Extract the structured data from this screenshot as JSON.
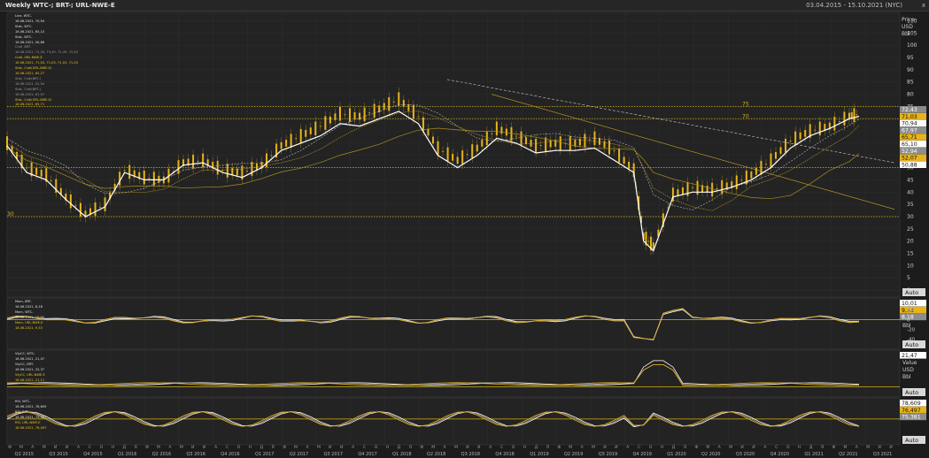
{
  "header": {
    "title": "Weekly WTC-; BRT-; URL-NWE-E",
    "date_range": "03.04.2015 - 15.10.2021 (NYC)",
    "close": "x"
  },
  "colors": {
    "bg": "#1c1c1c",
    "panel": "#232323",
    "grid": "#2f2f2f",
    "white": "#ffffff",
    "yellow": "#e8b31a",
    "gold": "#c9a227",
    "gray": "#a0a0a0",
    "level": "#d4b21a"
  },
  "chart_data": [
    {
      "type": "line",
      "panel": "price",
      "ylabel": "Price USD Bbl",
      "yticks": [
        0,
        5,
        10,
        15,
        20,
        25,
        30,
        35,
        40,
        45,
        50,
        55,
        60,
        65,
        70,
        75,
        80,
        85,
        90,
        95,
        100,
        105,
        110
      ],
      "ylim": [
        0,
        112
      ],
      "x_quarters": [
        "Q2 2015",
        "Q3 2015",
        "Q4 2015",
        "Q1 2016",
        "Q2 2016",
        "Q3 2016",
        "Q4 2016",
        "Q1 2017",
        "Q2 2017",
        "Q3 2017",
        "Q4 2017",
        "Q1 2018",
        "Q2 2018",
        "Q3 2018",
        "Q4 2018",
        "Q1 2019",
        "Q2 2019",
        "Q3 2019",
        "Q4 2019",
        "Q1 2020",
        "Q2 2020",
        "Q3 2020",
        "Q4 2020",
        "Q1 2021",
        "Q2 2021",
        "Q3 2021"
      ],
      "levels": [
        {
          "label": "75",
          "value": 75
        },
        {
          "label": "70",
          "value": 70
        },
        {
          "label": "",
          "value": 50
        },
        {
          "label": "30",
          "value": 30
        }
      ],
      "series": [
        {
          "name": "WTC",
          "points": [
            [
              0,
              59
            ],
            [
              2,
              48
            ],
            [
              4,
              45
            ],
            [
              6,
              37
            ],
            [
              8,
              30
            ],
            [
              10,
              34
            ],
            [
              12,
              48
            ],
            [
              14,
              45
            ],
            [
              16,
              45
            ],
            [
              18,
              51
            ],
            [
              20,
              52
            ],
            [
              22,
              48
            ],
            [
              24,
              46
            ],
            [
              26,
              50
            ],
            [
              28,
              57
            ],
            [
              30,
              60
            ],
            [
              32,
              63
            ],
            [
              34,
              68
            ],
            [
              36,
              67
            ],
            [
              38,
              70
            ],
            [
              40,
              73
            ],
            [
              42,
              68
            ],
            [
              44,
              55
            ],
            [
              46,
              50
            ],
            [
              48,
              55
            ],
            [
              50,
              62
            ],
            [
              52,
              60
            ],
            [
              54,
              56
            ],
            [
              56,
              57
            ],
            [
              58,
              57
            ],
            [
              60,
              58
            ],
            [
              62,
              53
            ],
            [
              64,
              48
            ],
            [
              65,
              20
            ],
            [
              66,
              16
            ],
            [
              68,
              38
            ],
            [
              70,
              40
            ],
            [
              72,
              40
            ],
            [
              74,
              42
            ],
            [
              76,
              45
            ],
            [
              78,
              50
            ],
            [
              80,
              58
            ],
            [
              82,
              63
            ],
            [
              84,
              66
            ],
            [
              86,
              70
            ],
            [
              87,
              71
            ]
          ]
        },
        {
          "name": "BRT",
          "points": [
            [
              0,
              62
            ],
            [
              2,
              52
            ],
            [
              4,
              49
            ],
            [
              6,
              40
            ],
            [
              8,
              32
            ],
            [
              10,
              37
            ],
            [
              12,
              50
            ],
            [
              14,
              47
            ],
            [
              16,
              46
            ],
            [
              18,
              53
            ],
            [
              20,
              55
            ],
            [
              22,
              50
            ],
            [
              24,
              49
            ],
            [
              26,
              53
            ],
            [
              28,
              61
            ],
            [
              30,
              65
            ],
            [
              32,
              69
            ],
            [
              34,
              74
            ],
            [
              36,
              73
            ],
            [
              38,
              76
            ],
            [
              40,
              80
            ],
            [
              42,
              73
            ],
            [
              44,
              60
            ],
            [
              46,
              55
            ],
            [
              48,
              60
            ],
            [
              50,
              68
            ],
            [
              52,
              65
            ],
            [
              54,
              61
            ],
            [
              56,
              62
            ],
            [
              58,
              62
            ],
            [
              60,
              63
            ],
            [
              62,
              58
            ],
            [
              64,
              50
            ],
            [
              65,
              26
            ],
            [
              66,
              22
            ],
            [
              68,
              40
            ],
            [
              70,
              43
            ],
            [
              72,
              42
            ],
            [
              74,
              44
            ],
            [
              76,
              48
            ],
            [
              78,
              55
            ],
            [
              80,
              63
            ],
            [
              82,
              66
            ],
            [
              84,
              68
            ],
            [
              86,
              72
            ],
            [
              87,
              73
            ]
          ]
        },
        {
          "name": "URL-NWE-E",
          "points": [
            [
              0,
              60
            ],
            [
              2,
              50
            ],
            [
              4,
              47
            ],
            [
              6,
              38
            ],
            [
              8,
              31
            ],
            [
              10,
              35
            ],
            [
              12,
              49
            ],
            [
              14,
              46
            ],
            [
              16,
              45
            ],
            [
              18,
              52
            ],
            [
              20,
              53
            ],
            [
              22,
              49
            ],
            [
              24,
              48
            ],
            [
              26,
              51
            ],
            [
              28,
              59
            ],
            [
              30,
              63
            ],
            [
              32,
              67
            ],
            [
              34,
              72
            ],
            [
              36,
              71
            ],
            [
              38,
              74
            ],
            [
              40,
              78
            ],
            [
              42,
              71
            ],
            [
              44,
              58
            ],
            [
              46,
              53
            ],
            [
              48,
              58
            ],
            [
              50,
              66
            ],
            [
              52,
              63
            ],
            [
              54,
              59
            ],
            [
              56,
              60
            ],
            [
              58,
              60
            ],
            [
              60,
              62
            ],
            [
              62,
              57
            ],
            [
              64,
              49
            ],
            [
              65,
              22
            ],
            [
              66,
              18
            ],
            [
              68,
              39
            ],
            [
              70,
              42
            ],
            [
              72,
              41
            ],
            [
              74,
              43
            ],
            [
              76,
              47
            ],
            [
              78,
              53
            ],
            [
              80,
              61
            ],
            [
              82,
              65
            ],
            [
              84,
              67
            ],
            [
              86,
              71
            ],
            [
              87,
              72
            ]
          ]
        }
      ],
      "price_labels": [
        {
          "text": "72,43",
          "style": "gray"
        },
        {
          "text": "71,03",
          "style": "yellow"
        },
        {
          "text": "70,94",
          "style": "white"
        },
        {
          "text": "67,97",
          "style": "gray"
        },
        {
          "text": "65,71",
          "style": "yellow"
        },
        {
          "text": "65,10",
          "style": "white"
        },
        {
          "text": "52,94",
          "style": "gray"
        },
        {
          "text": "52,07",
          "style": "yellow"
        },
        {
          "text": "50,88",
          "style": "white"
        }
      ],
      "legend": [
        {
          "text": "Line, WTC-",
          "c": "w"
        },
        {
          "text": "18.06.2021, 70,94",
          "c": "w"
        },
        {
          "text": "Stdc, WTC-",
          "c": "w"
        },
        {
          "text": "18.06.2021, 65,10",
          "c": "w"
        },
        {
          "text": "Stdc, WTC-",
          "c": "w"
        },
        {
          "text": "18.06.2021, 50,88",
          "c": "w"
        },
        {
          "text": "Cndl, BRT-",
          "c": "g"
        },
        {
          "text": "18.06.2021, 72,43, 73,49, 72,49, 72,43",
          "c": "g"
        },
        {
          "text": "Cndl, URL-NWE-E",
          "c": "y"
        },
        {
          "text": "18.06.2021, 71,03, 71,03, 71,03, 71,03",
          "c": "y"
        },
        {
          "text": "Stdc, Cndl(URL-NWE-E)",
          "c": "y"
        },
        {
          "text": "18.06.2021, 65,27",
          "c": "y"
        },
        {
          "text": "Stdc, Cndl(BRT-)",
          "c": "g"
        },
        {
          "text": "18.06.2021, 52,94",
          "c": "g"
        },
        {
          "text": "Stdc, Cndl(BRT-)",
          "c": "g"
        },
        {
          "text": "18.06.2021, 67,97",
          "c": "g"
        },
        {
          "text": "Stdc, Cndl(URL-NWE-E)",
          "c": "y"
        },
        {
          "text": "18.06.2021, 65,71",
          "c": "y"
        }
      ]
    },
    {
      "type": "line",
      "panel": "momentum",
      "yticks": [
        -40,
        -20,
        0,
        20
      ],
      "ylabel": "Bbl",
      "ylim": [
        -45,
        25
      ],
      "value_labels": [
        {
          "text": "10,01",
          "style": "white"
        },
        {
          "text": "9,33",
          "style": "yellow"
        },
        {
          "text": "8,18",
          "style": "gray"
        }
      ],
      "legend": [
        {
          "text": "Mom, BRT-",
          "c": "w"
        },
        {
          "text": "18.06.2021, 8,18",
          "c": "w"
        },
        {
          "text": "Mom, WTC-",
          "c": "w"
        },
        {
          "text": "18.06.2021, 10,01",
          "c": "w"
        },
        {
          "text": "Mom, URL-NWE-E",
          "c": "y"
        },
        {
          "text": "18.06.2021, 9,33",
          "c": "y"
        }
      ]
    },
    {
      "type": "line",
      "panel": "volatility",
      "ylabel": "Value USD Bbl",
      "value_labels": [
        {
          "text": "21,47",
          "style": "white"
        }
      ],
      "legend": [
        {
          "text": "VtyCC, WTC-",
          "c": "w"
        },
        {
          "text": "18.06.2021, 21,47",
          "c": "w"
        },
        {
          "text": "VtyCC, BRT-",
          "c": "w"
        },
        {
          "text": "18.06.2021, 22,37",
          "c": "w"
        },
        {
          "text": "VtyCC, URL-NWE-E",
          "c": "y"
        },
        {
          "text": "18.06.2021, 21,11",
          "c": "y"
        }
      ]
    },
    {
      "type": "line",
      "panel": "rsi",
      "value_labels": [
        {
          "text": "78,609",
          "style": "white"
        },
        {
          "text": "76,497",
          "style": "yellow"
        },
        {
          "text": "75,381",
          "style": "gray"
        }
      ],
      "legend": [
        {
          "text": "RSI, WTC-",
          "c": "w"
        },
        {
          "text": "18.06.2021, 78,609",
          "c": "w"
        },
        {
          "text": "RSI, BRT-",
          "c": "w"
        },
        {
          "text": "18.06.2021, 75,381",
          "c": "w"
        },
        {
          "text": "RSI, URL-NWE-E",
          "c": "y"
        },
        {
          "text": "18.06.2021, 76,497",
          "c": "y"
        }
      ]
    }
  ],
  "auto_label": "Auto"
}
